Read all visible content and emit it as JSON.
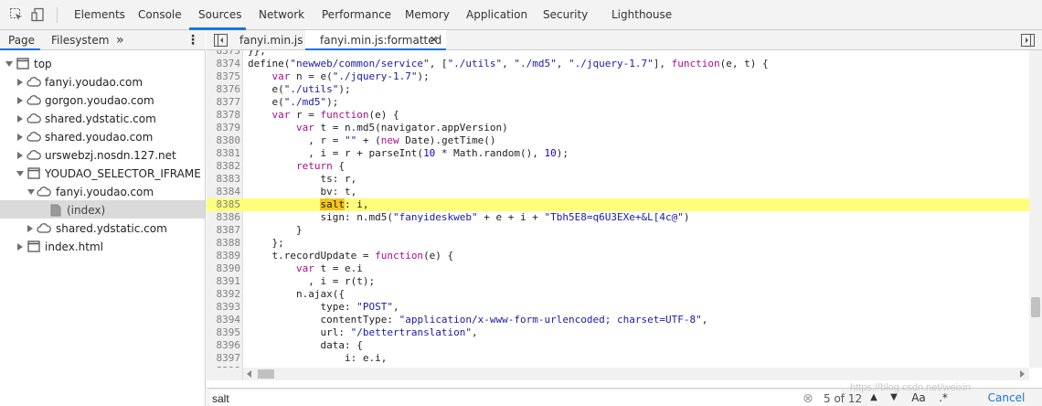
{
  "toolbar": {
    "inspect_icon": "inspect-element-icon",
    "device_icon": "device-toolbar-icon",
    "tabs": [
      "Elements",
      "Console",
      "Sources",
      "Network",
      "Performance",
      "Memory",
      "Application",
      "Security",
      "Lighthouse"
    ],
    "active_tab": "Sources"
  },
  "navigator": {
    "tabs": [
      "Page",
      "Filesystem"
    ],
    "more": "»",
    "menu": "⋮",
    "tree": [
      {
        "label": "top",
        "expanded": true,
        "icon": "frame-icon"
      },
      {
        "label": "fanyi.youdao.com",
        "expanded": false,
        "icon": "cloud-icon"
      },
      {
        "label": "gorgon.youdao.com",
        "expanded": false,
        "icon": "cloud-icon"
      },
      {
        "label": "shared.ydstatic.com",
        "expanded": false,
        "icon": "cloud-icon"
      },
      {
        "label": "shared.youdao.com",
        "expanded": false,
        "icon": "cloud-icon"
      },
      {
        "label": "urswebzj.nosdn.127.net",
        "expanded": false,
        "icon": "cloud-icon"
      },
      {
        "label": "YOUDAO_SELECTOR_IFRAME (fan",
        "expanded": true,
        "icon": "frame-icon"
      },
      {
        "label": "fanyi.youdao.com",
        "expanded": true,
        "icon": "cloud-icon"
      },
      {
        "label": "(index)",
        "expanded": null,
        "icon": "file-icon"
      },
      {
        "label": "shared.ydstatic.com",
        "expanded": false,
        "icon": "cloud-icon"
      },
      {
        "label": "index.html",
        "expanded": false,
        "icon": "frame-icon"
      }
    ]
  },
  "editor": {
    "tabs": [
      {
        "label": "fanyi.min.js",
        "active": false
      },
      {
        "label": "fanyi.min.js:formatted",
        "active": true,
        "close": "✕"
      }
    ],
    "lines": [
      {
        "n": "8373",
        "t": "}},"
      },
      {
        "n": "8374",
        "t": "define(\"newweb/common/service\", [\"./utils\", \"./md5\", \"./jquery-1.7\"], function(e, t) {"
      },
      {
        "n": "8375",
        "t": "    var n = e(\"./jquery-1.7\");"
      },
      {
        "n": "8376",
        "t": "    e(\"./utils\");"
      },
      {
        "n": "8377",
        "t": "    e(\"./md5\");"
      },
      {
        "n": "8378",
        "t": "    var r = function(e) {"
      },
      {
        "n": "8379",
        "t": "        var t = n.md5(navigator.appVersion)"
      },
      {
        "n": "8380",
        "t": "          , r = \"\" + (new Date).getTime()"
      },
      {
        "n": "8381",
        "t": "          , i = r + parseInt(10 * Math.random(), 10);"
      },
      {
        "n": "8382",
        "t": "        return {"
      },
      {
        "n": "8383",
        "t": "            ts: r,"
      },
      {
        "n": "8384",
        "t": "            bv: t,"
      },
      {
        "n": "8385",
        "t": "            salt: i,"
      },
      {
        "n": "8386",
        "t": "            sign: n.md5(\"fanyideskweb\" + e + i + \"Tbh5E8=q6U3EXe+&L[4c@\")"
      },
      {
        "n": "8387",
        "t": "        }"
      },
      {
        "n": "8388",
        "t": "    };"
      },
      {
        "n": "8389",
        "t": "    t.recordUpdate = function(e) {"
      },
      {
        "n": "8390",
        "t": "        var t = e.i"
      },
      {
        "n": "8391",
        "t": "          , i = r(t);"
      },
      {
        "n": "8392",
        "t": "        n.ajax({"
      },
      {
        "n": "8393",
        "t": "            type: \"POST\","
      },
      {
        "n": "8394",
        "t": "            contentType: \"application/x-www-form-urlencoded; charset=UTF-8\","
      },
      {
        "n": "8395",
        "t": "            url: \"/bettertranslation\","
      },
      {
        "n": "8396",
        "t": "            data: {"
      },
      {
        "n": "8397",
        "t": "                i: e.i,"
      },
      {
        "n": "8398",
        "t": ""
      }
    ],
    "highlight_line": "8385"
  },
  "search": {
    "value": "salt",
    "count": "5 of 12",
    "aa": "Aa",
    "regex": ".*",
    "cancel": "Cancel",
    "up": "▲",
    "down": "▼",
    "clear": "⊗"
  },
  "watermark": "https://blog.csdn.net/weixin"
}
